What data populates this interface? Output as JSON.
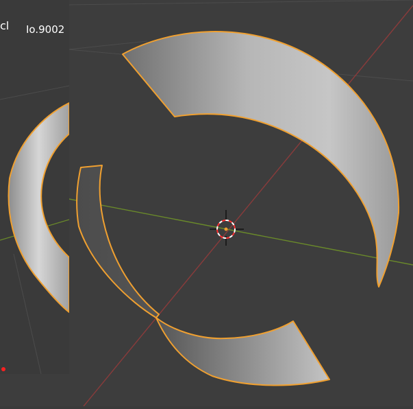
{
  "overlay": {
    "text_left": "cl",
    "text_right": "Io.9002"
  },
  "colors": {
    "background": "#3d3d3d",
    "grid": "#4c4c4c",
    "x_axis": "#8a3b3b",
    "y_axis": "#6a8a2a",
    "selection_outline": "#f0a030",
    "mesh_fill": "#b8b8b8",
    "cursor_red": "#ff3030",
    "cursor_white": "#ffffff"
  },
  "icons": {
    "cursor": "3d-cursor-icon",
    "origin": "object-origin-icon"
  }
}
